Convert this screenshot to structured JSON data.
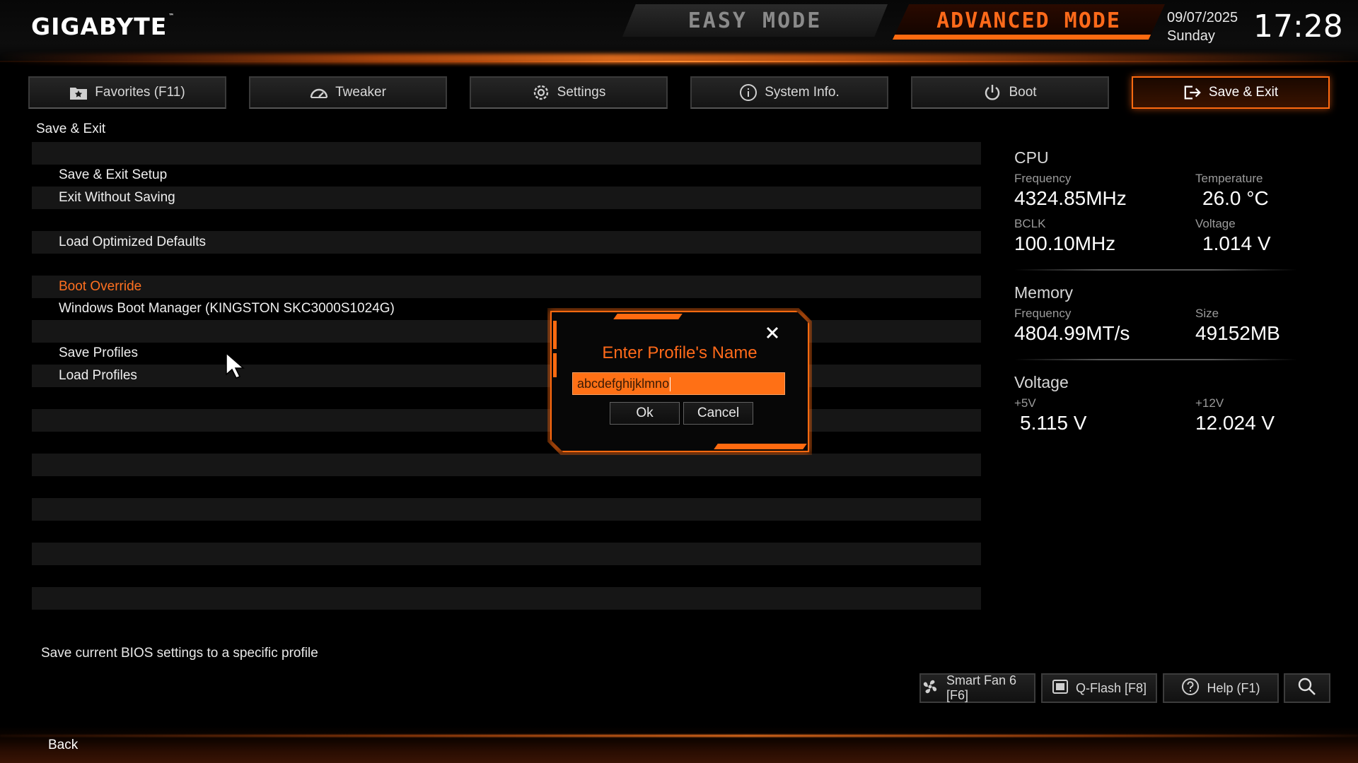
{
  "header": {
    "logo": "GIGABYTE",
    "logo_mark": "™",
    "easy_mode": "EASY MODE",
    "advanced_mode": "ADVANCED MODE",
    "date": "09/07/2025",
    "day": "Sunday",
    "time": "17:28"
  },
  "nav": {
    "tabs": [
      {
        "label": "Favorites (F11)",
        "icon": "star-folder-icon"
      },
      {
        "label": "Tweaker",
        "icon": "speedometer-icon"
      },
      {
        "label": "Settings",
        "icon": "gear-icon"
      },
      {
        "label": "System Info.",
        "icon": "info-icon"
      },
      {
        "label": "Boot",
        "icon": "power-icon"
      },
      {
        "label": "Save & Exit",
        "icon": "exit-icon",
        "active": true
      }
    ]
  },
  "main": {
    "section_title": "Save & Exit",
    "items": {
      "save_exit_setup": "Save & Exit Setup",
      "exit_without_saving": "Exit Without Saving",
      "load_optimized_defaults": "Load Optimized Defaults",
      "boot_override": "Boot Override",
      "windows_boot_manager": "Windows Boot Manager (KINGSTON SKC3000S1024G)",
      "save_profiles": "Save Profiles",
      "load_profiles": "Load Profiles"
    },
    "description": "Save current BIOS settings to a specific profile"
  },
  "panel": {
    "cpu": {
      "title": "CPU",
      "frequency_label": "Frequency",
      "frequency": "4324.85MHz",
      "temperature_label": "Temperature",
      "temperature": "26.0 °C",
      "bclk_label": "BCLK",
      "bclk": "100.10MHz",
      "voltage_label": "Voltage",
      "voltage": "1.014 V"
    },
    "memory": {
      "title": "Memory",
      "frequency_label": "Frequency",
      "frequency": "4804.99MT/s",
      "size_label": "Size",
      "size": "49152MB"
    },
    "voltage": {
      "title": "Voltage",
      "v5_label": "+5V",
      "v5": "5.115 V",
      "v12_label": "+12V",
      "v12": "12.024 V"
    }
  },
  "dialog": {
    "title": "Enter Profile's Name",
    "input_value": "abcdefghijklmno",
    "ok_label": "Ok",
    "cancel_label": "Cancel"
  },
  "toolbar": {
    "smart_fan": "Smart Fan 6 [F6]",
    "qflash": "Q-Flash [F8]",
    "help": "Help (F1)"
  },
  "footer": {
    "back": "Back"
  },
  "colors": {
    "accent": "#ff6a10",
    "background": "#000000",
    "row_shade": "#161616"
  }
}
